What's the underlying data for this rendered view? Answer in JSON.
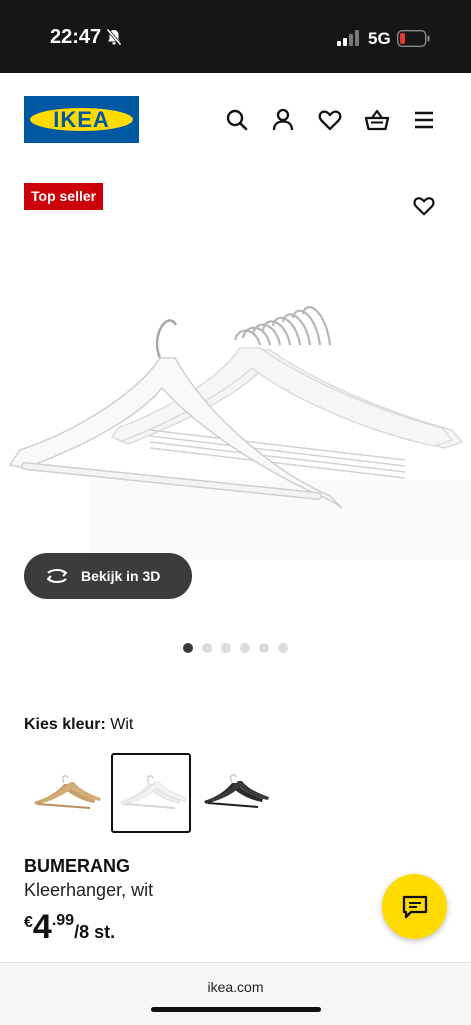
{
  "status_bar": {
    "time": "22:47",
    "network": "5G",
    "bell_icon": "bell-slash-icon",
    "battery_color": "#e53935"
  },
  "header": {
    "logo_text": "IKEA",
    "logo_colors": {
      "blue": "#0058a3",
      "yellow": "#ffdb00"
    },
    "icons": [
      "search-icon",
      "account-icon",
      "heart-icon",
      "basket-icon",
      "menu-icon"
    ]
  },
  "product_card": {
    "badge": "Top seller",
    "badge_color": "#cc0008",
    "view_3d_label": "Bekijk in 3D",
    "carousel": {
      "total": 6,
      "active": 1
    }
  },
  "color_picker": {
    "label": "Kies kleur:",
    "selected_value": "Wit",
    "swatches": [
      {
        "name": "naturel",
        "selected": false
      },
      {
        "name": "wit",
        "selected": true
      },
      {
        "name": "zwart",
        "selected": false
      }
    ]
  },
  "product": {
    "name": "BUMERANG",
    "description": "Kleerhanger, wit",
    "price": {
      "currency": "€",
      "integer": "4",
      "decimal": ".99",
      "unit": "/8 st."
    }
  },
  "browser": {
    "url": "ikea.com"
  }
}
